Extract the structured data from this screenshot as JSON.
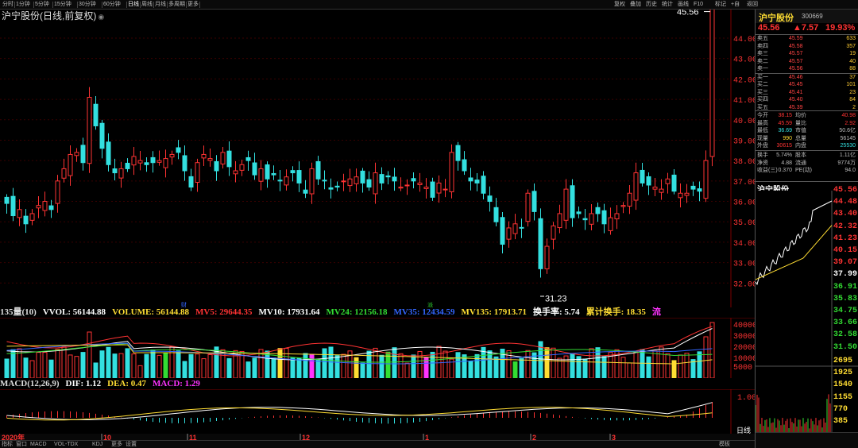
{
  "toolbar": {
    "left": [
      "分时",
      "1分钟",
      "5分钟",
      "15分钟",
      "30分钟",
      "60分钟",
      "日线",
      "周线",
      "月线",
      "多周期",
      "更多"
    ],
    "active": "日线",
    "right": [
      "复权",
      "叠加",
      "历史",
      "统计",
      "画线",
      "F10",
      "标记",
      "+自",
      "返回"
    ]
  },
  "title": "沪宁股份(日线,前复权)",
  "price_axis": [
    "44.00",
    "43.00",
    "42.00",
    "41.00",
    "40.00",
    "39.00",
    "38.00",
    "37.00",
    "36.00",
    "35.00",
    "34.00",
    "33.00",
    "32.00"
  ],
  "annotations": {
    "high_label": "45.56",
    "low_label": "31.23",
    "event_markers": [
      "财",
      "派"
    ]
  },
  "volume_line": {
    "name": "135量(10)",
    "vvol": "VVOL: 56144.88",
    "volume": "VOLUME: 56144.88",
    "mv5": "MV5: 29644.35",
    "mv10": "MV10: 17931.64",
    "mv24": "MV24: 12156.18",
    "mv35": "MV35: 12434.59",
    "mv135": "MV135: 17913.71",
    "turnover": "换手率: 5.74",
    "cum_turnover": "累计换手: 18.35",
    "extra": "流"
  },
  "volume_axis": [
    "40000",
    "30000",
    "20000",
    "10000",
    "5000"
  ],
  "macd_line": {
    "name": "MACD(12,26,9)",
    "dif": "DIF: 1.12",
    "dea": "DEA: 0.47",
    "macd": "MACD: 1.29"
  },
  "macd_axis": [
    "1.00"
  ],
  "date_axis": {
    "year": "2020年",
    "months": [
      "10",
      "11",
      "12",
      "1",
      "2",
      "3"
    ]
  },
  "bottom_tabs": [
    "指标",
    "窗口",
    "MACD",
    "VOL-TDX",
    "KDJ",
    "更多",
    "设置"
  ],
  "bottom_right": [
    "模板"
  ],
  "right_panel": {
    "name": "沪宁股份",
    "code": "300669",
    "price": "45.56",
    "change": "▲7.57",
    "pct": "19.93%",
    "asks": [
      {
        "label": "卖五",
        "price": "45.59",
        "vol": "633"
      },
      {
        "label": "卖四",
        "price": "45.58",
        "vol": "357"
      },
      {
        "label": "卖三",
        "price": "45.57",
        "vol": "19"
      },
      {
        "label": "卖二",
        "price": "45.57",
        "vol": "40"
      },
      {
        "label": "卖一",
        "price": "45.56",
        "vol": "88"
      }
    ],
    "bids": [
      {
        "label": "买一",
        "price": "45.46",
        "vol": "37"
      },
      {
        "label": "买二",
        "price": "45.45",
        "vol": "101"
      },
      {
        "label": "买三",
        "price": "45.41",
        "vol": "23"
      },
      {
        "label": "买四",
        "price": "45.40",
        "vol": "84"
      },
      {
        "label": "买五",
        "price": "45.39",
        "vol": "2"
      }
    ],
    "stats": [
      [
        "今开",
        "38.15",
        "均价",
        "40.98"
      ],
      [
        "最高",
        "45.59",
        "量比",
        "2.92"
      ],
      [
        "最低",
        "36.69",
        "市值",
        "50.6亿"
      ],
      [
        "现量",
        "990",
        "总量",
        "56145"
      ],
      [
        "外盘",
        "30615",
        "内盘",
        "25530"
      ]
    ],
    "stats2": [
      [
        "换手",
        "5.74%",
        "股本",
        "1.11亿"
      ],
      [
        "净资",
        "4.88",
        "流通",
        "9774万"
      ],
      [
        "收益(三)",
        "0.370",
        "PE(动)",
        "94.0"
      ]
    ],
    "mini_title": "沪宁股份",
    "mini_prices": [
      "45.56",
      "44.48",
      "43.40",
      "42.32",
      "41.23",
      "40.15",
      "39.07",
      "37.99",
      "36.91",
      "35.83",
      "34.75",
      "33.66",
      "32.58",
      "31.50"
    ],
    "mini_vol": [
      "2695",
      "1925",
      "1540",
      "1155",
      "770",
      "385"
    ],
    "mini_tab": "日线"
  },
  "colors": {
    "up": "#ff3333",
    "down": "#33e0e0",
    "yellow": "#ffdd33",
    "green": "#33dd33",
    "magenta": "#ff33ff",
    "white": "#ffffff",
    "blue": "#3366ff"
  }
}
